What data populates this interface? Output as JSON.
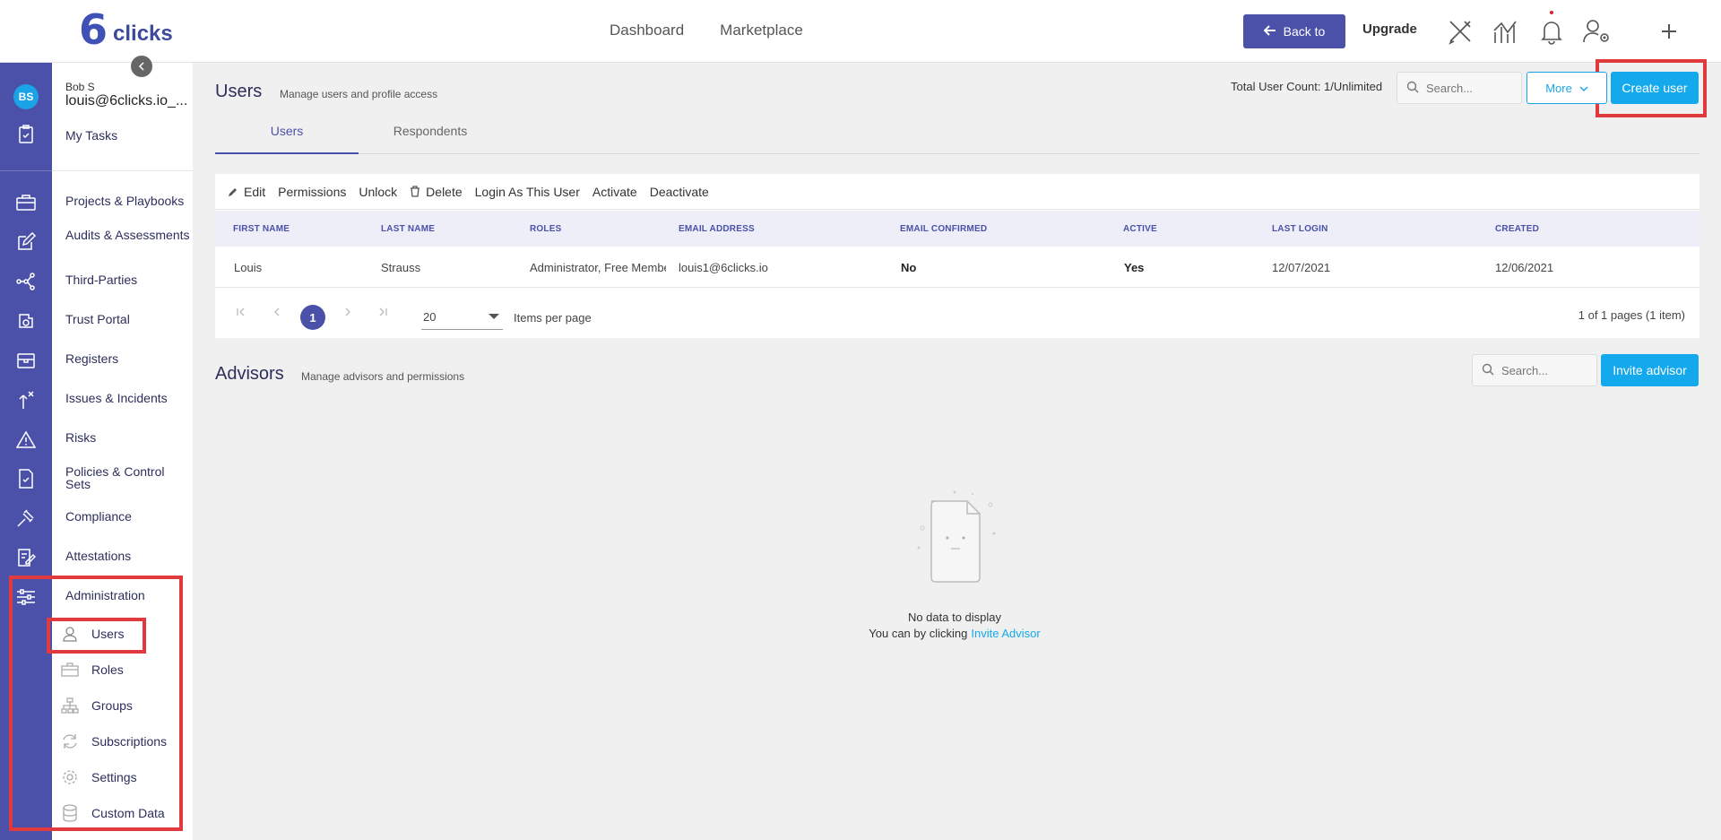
{
  "header": {
    "logo_mark": "6",
    "logo_text": "clicks",
    "nav": [
      "Dashboard",
      "Marketplace"
    ],
    "back_label": "Back to",
    "upgrade_label": "Upgrade"
  },
  "user": {
    "initials": "BS",
    "name": "Bob S",
    "email": "louis@6clicks.io_..."
  },
  "menu": {
    "my_tasks": "My Tasks",
    "items": [
      "Projects & Playbooks",
      "Audits & Assessments",
      "Third-Parties",
      "Trust Portal",
      "Registers",
      "Issues & Incidents",
      "Risks",
      "Policies & Control Sets",
      "Compliance",
      "Attestations",
      "Administration"
    ],
    "admin_sub": [
      "Users",
      "Roles",
      "Groups",
      "Subscriptions",
      "Settings",
      "Custom Data"
    ]
  },
  "users_section": {
    "title": "Users",
    "subtitle": "Manage users and profile access",
    "total_count": "Total User Count: 1/Unlimited",
    "search_placeholder": "Search...",
    "more_label": "More",
    "create_label": "Create user",
    "tabs": [
      "Users",
      "Respondents"
    ],
    "toolbar": [
      "Edit",
      "Permissions",
      "Unlock",
      "Delete",
      "Login As This User",
      "Activate",
      "Deactivate"
    ],
    "columns": [
      "FIRST NAME",
      "LAST NAME",
      "ROLES",
      "EMAIL ADDRESS",
      "EMAIL CONFIRMED",
      "ACTIVE",
      "LAST LOGIN",
      "CREATED"
    ],
    "rows": [
      [
        "Louis",
        "Strauss",
        "Administrator, Free Member",
        "louis1@6clicks.io",
        "No",
        "Yes",
        "12/07/2021",
        "12/06/2021"
      ]
    ],
    "pager": {
      "current": "1",
      "per_page": "20",
      "per_page_label": "Items per page",
      "info": "1 of 1 pages (1 item)"
    }
  },
  "advisors_section": {
    "title": "Advisors",
    "subtitle": "Manage advisors and permissions",
    "search_placeholder": "Search...",
    "invite_label": "Invite advisor",
    "empty_msg": "No data to display",
    "empty_sub": "You can by clicking",
    "empty_link": "Invite Advisor"
  },
  "colors": {
    "brand": "#4b51a8",
    "accent": "#13a9ec",
    "highlight": "#e03a3e"
  }
}
